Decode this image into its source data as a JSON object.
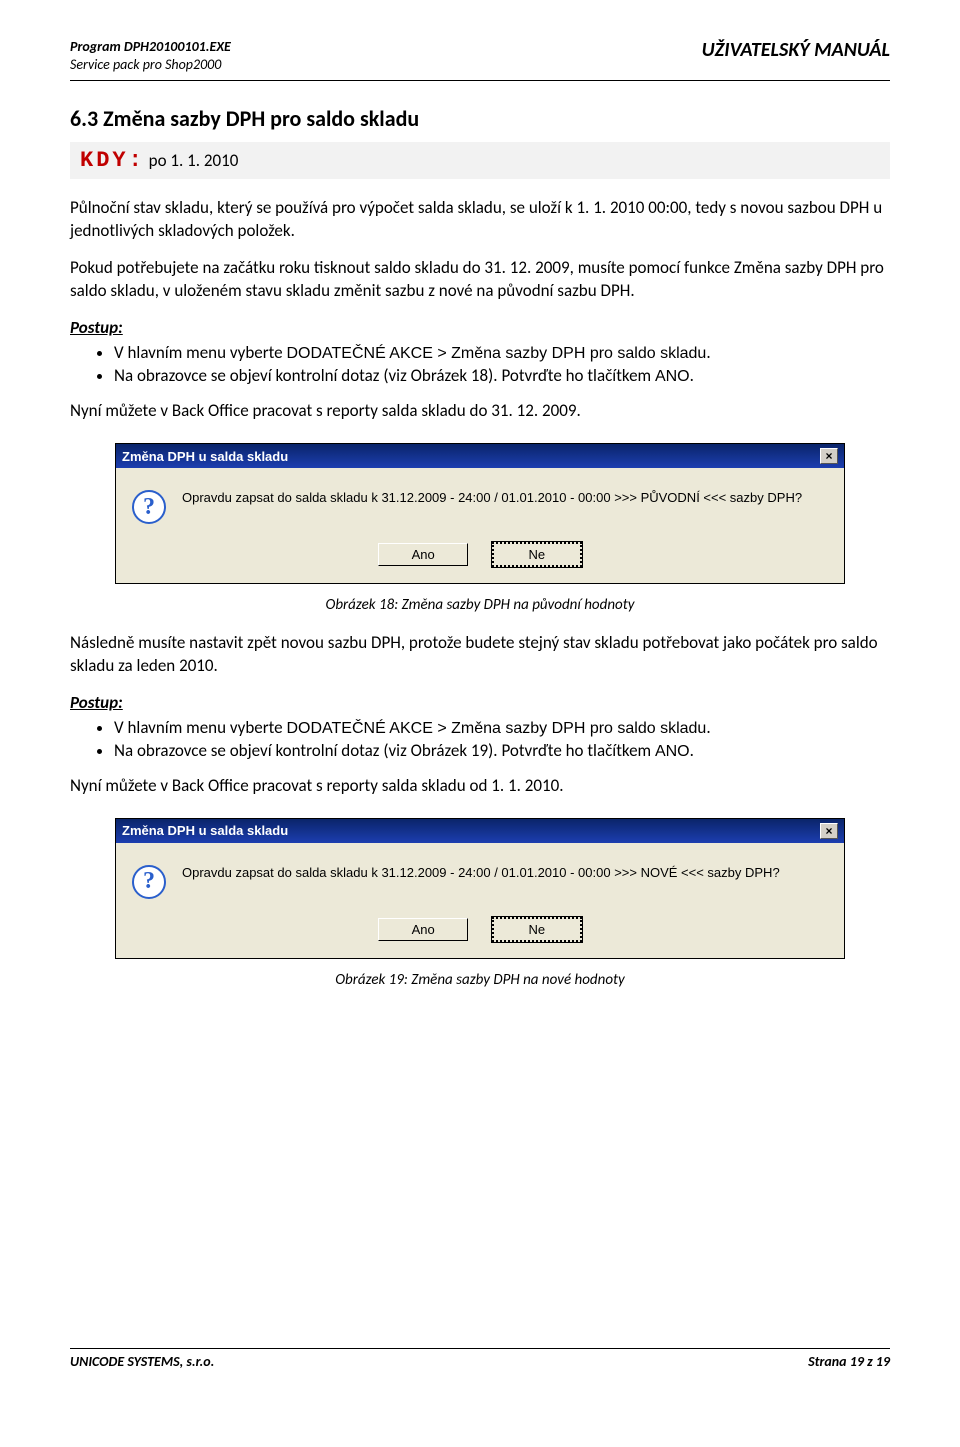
{
  "header": {
    "program_line": "Program DPH20100101.EXE",
    "subtitle": "Service pack pro Shop2000",
    "manual": "UŽIVATELSKÝ MANUÁL"
  },
  "section": {
    "heading": "6.3 Změna sazby DPH pro saldo skladu",
    "kdy_label": "KDY:",
    "kdy_value": "po 1. 1. 2010"
  },
  "paras": {
    "p1": "Půlnoční stav skladu, který se používá pro výpočet salda skladu, se uloží k 1. 1. 2010 00:00, tedy s novou sazbou DPH u jednotlivých skladových položek.",
    "p2": "Pokud potřebujete na začátku roku tisknout saldo skladu do 31. 12. 2009, musíte pomocí funkce Změna sazby DPH pro saldo skladu, v uloženém stavu skladu změnit sazbu z nové na původní sazbu DPH.",
    "postup": "Postup:",
    "b1a": "V hlavním menu vyberte ",
    "b1b_menu": "DODATEČNÉ AKCE > Změna sazby DPH pro saldo skladu",
    "b1c": ".",
    "b2a": "Na obrazovce se objeví kontrolní dotaz (viz Obrázek 18). Potvrďte ho tlačítkem ",
    "b2b_btn": "ANO",
    "b2c": ".",
    "p3": "Nyní můžete v Back Office pracovat s reporty salda skladu do 31. 12. 2009."
  },
  "dialog1": {
    "title": "Změna DPH u salda skladu",
    "message": "Opravdu zapsat do salda skladu k 31.12.2009 - 24:00 / 01.01.2010 - 00:00 >>> PŮVODNÍ <<< sazby DPH?",
    "btn_yes": "Ano",
    "btn_no": "Ne",
    "close": "×"
  },
  "caption1": "Obrázek 18: Změna sazby DPH na původní hodnoty",
  "paras2": {
    "p4": "Následně musíte nastavit zpět novou sazbu DPH, protože budete stejný stav skladu potřebovat jako počátek pro saldo skladu za leden 2010.",
    "b3a": "V hlavním menu vyberte ",
    "b3b_menu": "DODATEČNÉ AKCE > Změna sazby DPH pro saldo skladu",
    "b3c": ".",
    "b4a": "Na obrazovce se objeví kontrolní dotaz (viz Obrázek 19). Potvrďte ho tlačítkem ",
    "b4b_btn": "ANO",
    "b4c": ".",
    "p5": "Nyní můžete v Back Office pracovat s reporty salda skladu od 1. 1. 2010."
  },
  "dialog2": {
    "title": "Změna DPH u salda skladu",
    "message": "Opravdu zapsat do salda skladu k 31.12.2009 - 24:00 / 01.01.2010 - 00:00 >>> NOVÉ <<< sazby DPH?",
    "btn_yes": "Ano",
    "btn_no": "Ne",
    "close": "×"
  },
  "caption2": "Obrázek 19: Změna sazby DPH na nové hodnoty",
  "footer": {
    "company": "UNICODE SYSTEMS, s.r.o.",
    "page": "Strana 19 z 19"
  }
}
